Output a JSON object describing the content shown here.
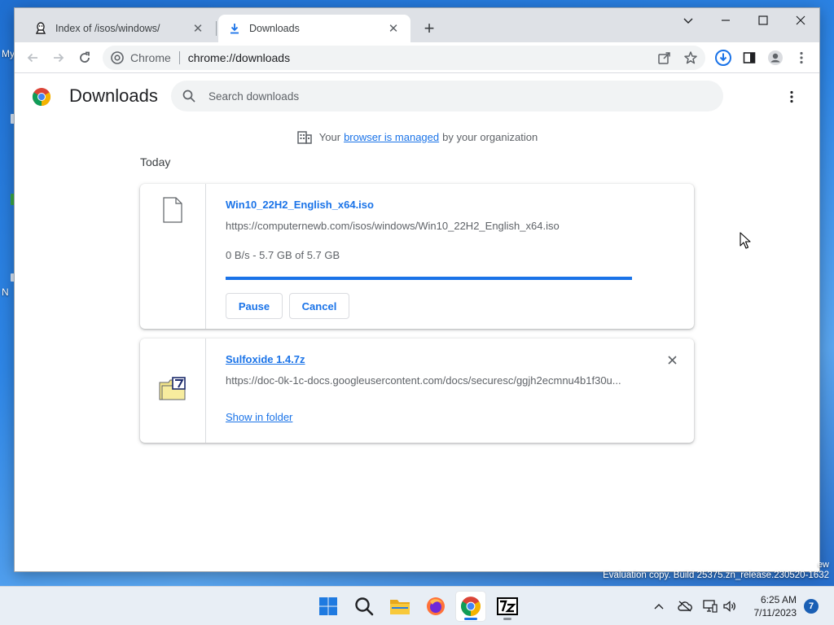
{
  "desktop": {
    "fragments": [
      "My",
      "N"
    ]
  },
  "tabs": [
    {
      "title": "Index of /isos/windows/",
      "icon": "tux-icon",
      "active": false
    },
    {
      "title": "Downloads",
      "icon": "download-icon",
      "active": true
    }
  ],
  "toolbar": {
    "site_name": "Chrome",
    "url": "chrome://downloads"
  },
  "downloads_page": {
    "title": "Downloads",
    "search_placeholder": "Search downloads",
    "managed_prefix": "Your",
    "managed_link": "browser is managed",
    "managed_suffix": "by your organization",
    "section_label": "Today",
    "items": [
      {
        "file_name": "Win10_22H2_English_x64.iso",
        "url": "https://computernewb.com/isos/windows/Win10_22H2_English_x64.iso",
        "status": "0 B/s - 5.7 GB of 5.7 GB",
        "progress_fraction": 1.0,
        "pause_label": "Pause",
        "cancel_label": "Cancel"
      },
      {
        "file_name": "Sulfoxide 1.4.7z",
        "url": "https://doc-0k-1c-docs.googleusercontent.com/docs/securesc/ggjh2ecmnu4b1f30u...",
        "show_in_folder_label": "Show in folder"
      }
    ]
  },
  "watermark": {
    "top": "ew",
    "text": "Evaluation copy. Build 25375.zn_release.230520-1632"
  },
  "taskbar": {
    "time": "6:25 AM",
    "date": "7/11/2023",
    "notification_count": "7"
  },
  "colors": {
    "accent": "#1a73e8",
    "tabstrip": "#dee1e6",
    "desktop": "#2e86e6"
  }
}
